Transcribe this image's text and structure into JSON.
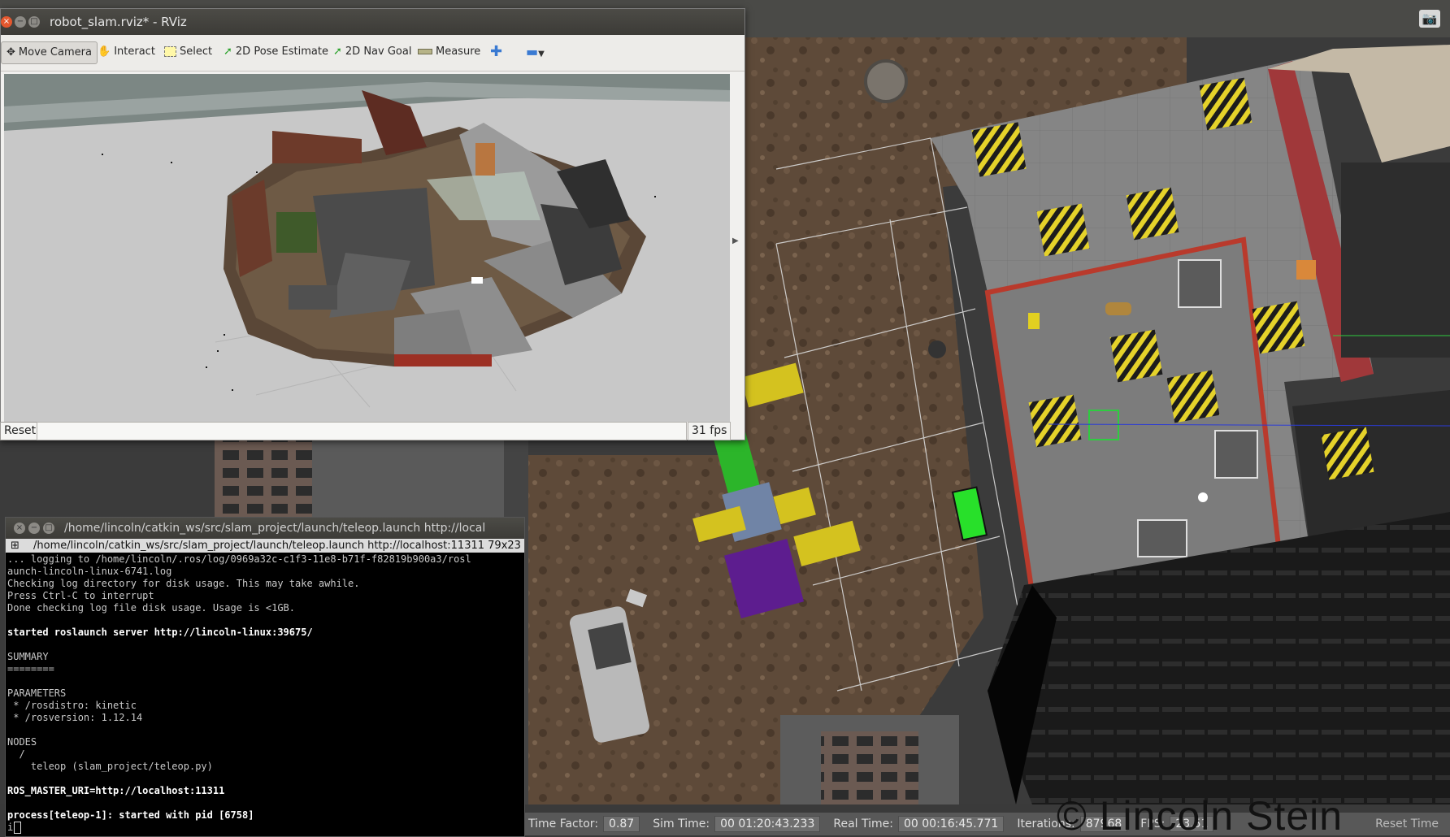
{
  "rviz": {
    "title": "robot_slam.rviz* - RViz",
    "toolbar": {
      "move_camera": "Move Camera",
      "interact": "Interact",
      "select": "Select",
      "pose_estimate": "2D Pose Estimate",
      "nav_goal": "2D Nav Goal",
      "measure": "Measure"
    },
    "reset_label": "Reset",
    "fps": "31 fps"
  },
  "terminal": {
    "title": "/home/lincoln/catkin_ws/src/slam_project/launch/teleop.launch http://local",
    "tab_title": "/home/lincoln/catkin_ws/src/slam_project/launch/teleop.launch http://localhost:11311 79x23",
    "lines": [
      "... logging to /home/lincoln/.ros/log/0969a32c-c1f3-11e8-b71f-f82819b900a3/rosl",
      "aunch-lincoln-linux-6741.log",
      "Checking log directory for disk usage. This may take awhile.",
      "Press Ctrl-C to interrupt",
      "Done checking log file disk usage. Usage is <1GB.",
      "",
      "started roslaunch server http://lincoln-linux:39675/",
      "",
      "SUMMARY",
      "========",
      "",
      "PARAMETERS",
      " * /rosdistro: kinetic",
      " * /rosversion: 1.12.14",
      "",
      "NODES",
      "  /",
      "    teleop (slam_project/teleop.py)",
      "",
      "ROS_MASTER_URI=http://localhost:11311",
      "",
      "process[teleop-1]: started with pid [6758]",
      "i"
    ],
    "bold_lines": [
      6,
      19,
      21
    ]
  },
  "gazebo": {
    "time_factor_label": "Time Factor:",
    "time_factor": "0.87",
    "sim_time_label": "Sim Time:",
    "sim_time": "00 01:20:43.233",
    "real_time_label": "Real Time:",
    "real_time": "00 00:16:45.771",
    "iterations_label": "Iterations:",
    "iterations": "87968",
    "fps_label": "FPS:",
    "fps": "23.51",
    "reset_time": "Reset Time"
  },
  "watermark": "© Lincoln Stein"
}
